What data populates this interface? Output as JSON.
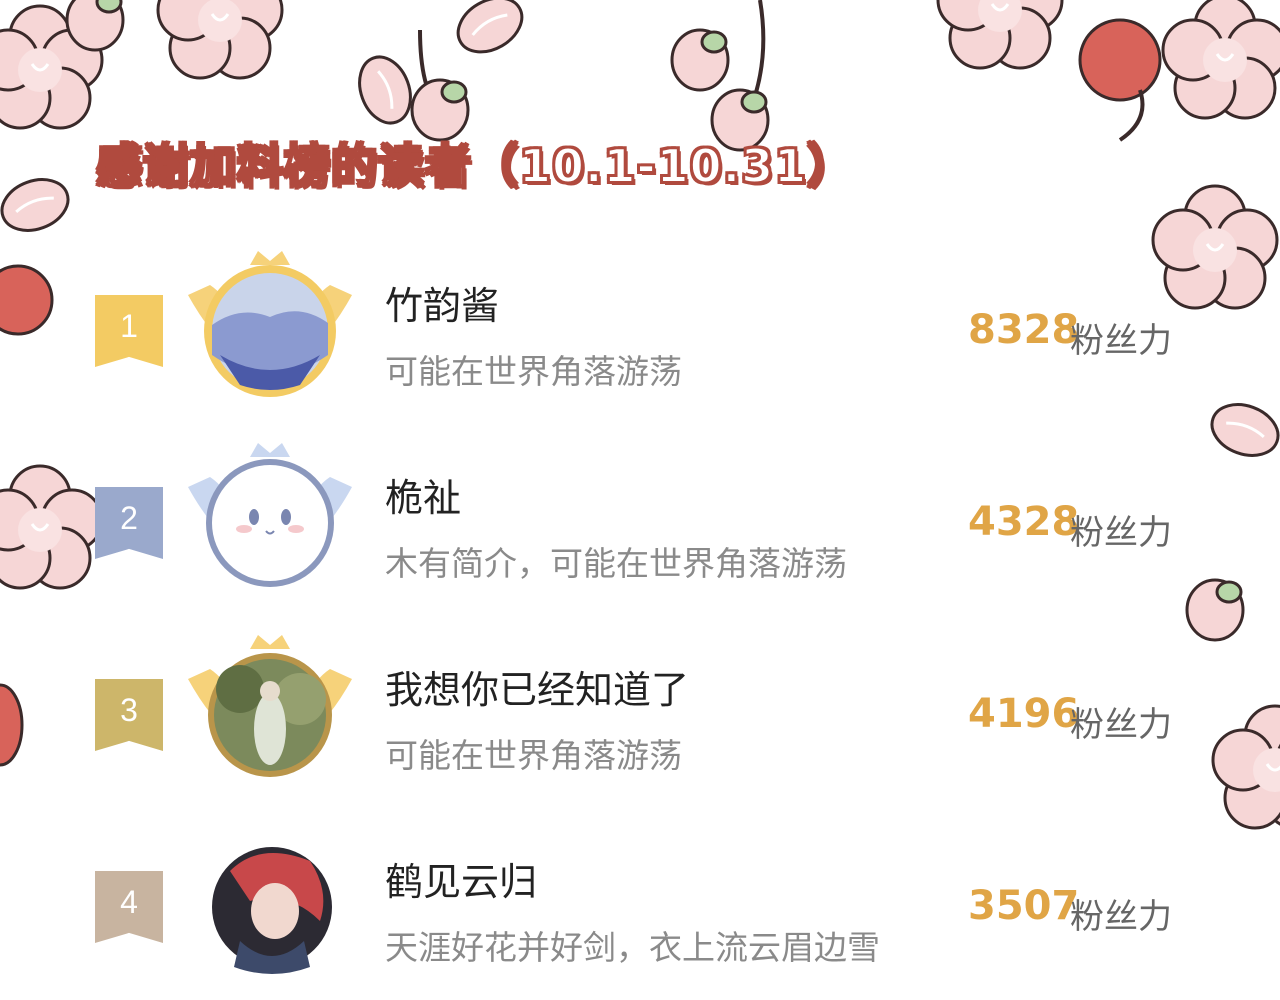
{
  "title": "感谢加料榜的读者（10.1-10.31）",
  "score_unit": "粉丝力",
  "colors": {
    "title_outline": "#b04a3e",
    "score": "#e0a546",
    "rank1": "#f3cb63",
    "rank2": "#9aa9cc",
    "rank3": "#cdb66a",
    "rank4": "#c8b4a0"
  },
  "readers": [
    {
      "rank": "1",
      "name": "竹韵酱",
      "bio": "可能在世界角落游荡",
      "score": "8328",
      "frame": "gold-wings"
    },
    {
      "rank": "2",
      "name": "桅祉",
      "bio": "木有简介，可能在世界角落游荡",
      "score": "4328",
      "frame": "blue-wings"
    },
    {
      "rank": "3",
      "name": "我想你已经知道了",
      "bio": "可能在世界角落游荡",
      "score": "4196",
      "frame": "gold-wings"
    },
    {
      "rank": "4",
      "name": "鹤见云归",
      "bio": "天涯好花并好剑，衣上流云眉边雪",
      "score": "3507",
      "frame": "none"
    }
  ]
}
